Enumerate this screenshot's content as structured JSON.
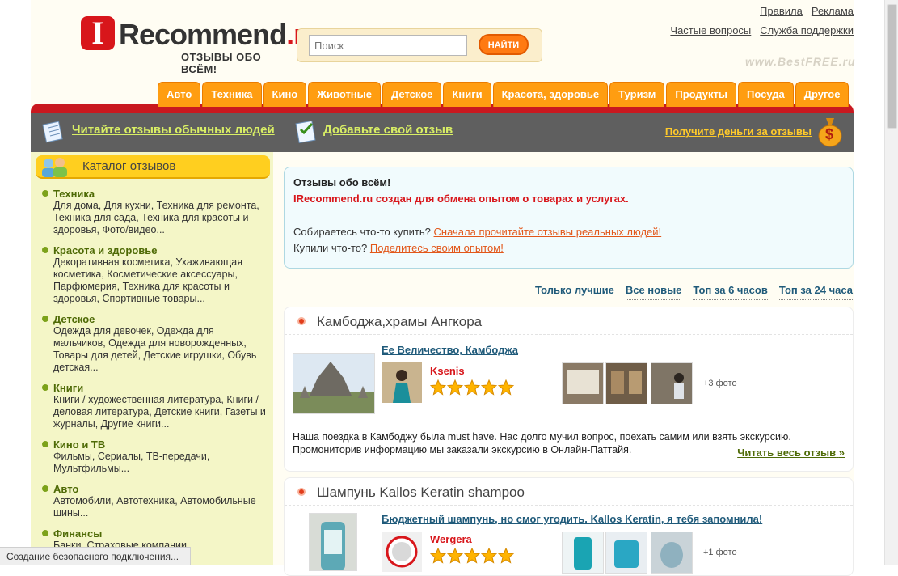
{
  "header": {
    "logo_letter": "I",
    "logo_name": "Recommend",
    "logo_tld": ".ru",
    "tagline": "ОТЗЫВЫ ОБО ВСЁМ!",
    "search": {
      "placeholder": "Поиск",
      "button": "НАЙТИ"
    },
    "links_row1": [
      "Правила",
      "Реклама"
    ],
    "links_row2": [
      "Частые вопросы",
      "Служба поддержки"
    ],
    "watermark": "www.BestFREE.ru"
  },
  "tabs": [
    "Авто",
    "Техника",
    "Кино",
    "Животные",
    "Детское",
    "Книги",
    "Красота, здоровье",
    "Туризм",
    "Продукты",
    "Посуда",
    "Другое"
  ],
  "action_bar": {
    "read": "Читайте отзывы обычных людей",
    "add": "Добавьте свой отзыв",
    "money": "Получите деньги за отзывы",
    "money_icon": "$"
  },
  "sidebar": {
    "title": "Каталог отзывов",
    "categories": [
      {
        "name": "Техника",
        "subs": "Для дома, Для кухни, Техника для ремонта, Техника для сада, Техника для красоты и здоровья, Фото/видео..."
      },
      {
        "name": "Красота и здоровье",
        "subs": "Декоративная косметика, Ухаживающая косметика, Косметические аксессуары, Парфюмерия, Техника для красоты и здоровья, Спортивные товары..."
      },
      {
        "name": "Детское",
        "subs": "Одежда для девочек, Одежда для мальчиков, Одежда для новорожденных, Товары для детей, Детские игрушки, Обувь детская..."
      },
      {
        "name": "Книги",
        "subs": "Книги / художественная литература, Книги / деловая литература, Детские книги, Газеты и журналы, Другие книги..."
      },
      {
        "name": "Кино и ТВ",
        "subs": "Фильмы, Сериалы, ТВ-передачи, Мультфильмы..."
      },
      {
        "name": "Авто",
        "subs": "Автомобили, Автотехника, Автомобильные шины..."
      },
      {
        "name": "Финансы",
        "subs": "Банки, Страховые компании"
      }
    ]
  },
  "welcome": {
    "line1": "Отзывы обо всём!",
    "line2": "IRecommend.ru создан для обмена опытом о товарах и услугах.",
    "line3_text": "Собираетесь что-то купить? ",
    "line3_link": "Сначала прочитайте отзывы реальных людей!",
    "line4_text": "Купили что-то? ",
    "line4_link": "Поделитесь своим опытом!"
  },
  "filters": [
    "Только лучшие",
    "Все новые",
    "Топ за 6 часов",
    "Топ за 24 часа"
  ],
  "reviews": [
    {
      "title": "Камбоджа,храмы Ангкора",
      "review_title": "Ее Величество, Камбоджа",
      "author": "Ksenis",
      "rating": 5,
      "more_photos": "+3 фото",
      "excerpt": "Наша поездка в Камбоджу была must have. Нас долго мучил вопрос, поехать самим или взять экскурсию. Промониторив информацию мы заказали экскурсию в Онлайн-Паттайя.",
      "read_more": "Читать весь отзыв"
    },
    {
      "title": "Шампунь Kallos Keratin shampoo",
      "review_title": "Бюджетный шампунь, но смог угодить. Kallos Keratin, я тебя запомнила!",
      "author": "Wergera",
      "rating": 5,
      "more_photos": "+1 фото"
    }
  ],
  "status_bar": "Создание безопасного подключения..."
}
